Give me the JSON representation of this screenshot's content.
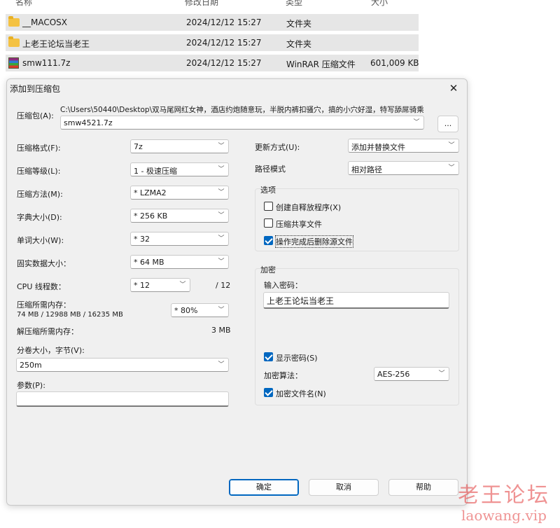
{
  "explorer": {
    "columns": [
      "名称",
      "修改日期",
      "类型",
      "大小"
    ],
    "files": [
      {
        "name": "__MACOSX",
        "date": "2024/12/12 15:27",
        "type": "文件夹",
        "size": "",
        "icon": "folder-icon"
      },
      {
        "name": "上老王论坛当老王",
        "date": "2024/12/12 15:27",
        "type": "文件夹",
        "size": "",
        "icon": "folder-icon"
      },
      {
        "name": "smw111.7z",
        "date": "2024/12/12 15:27",
        "type": "WinRAR 压缩文件",
        "size": "601,009 KB",
        "icon": "winrar-archive-icon"
      }
    ]
  },
  "dialog": {
    "title": "添加到压缩包",
    "archive": {
      "label": "压缩包(A):",
      "path": "C:\\Users\\50440\\Desktop\\双马尾网红女神，酒店约炮随意玩，半脱内裤扣骚穴，搞的小穴好湿，特写舔屌骑乘",
      "filename": "smw4521.7z",
      "browse_label": "..."
    },
    "left": {
      "format": {
        "label": "压缩格式(F):",
        "value": "7z"
      },
      "level": {
        "label": "压缩等级(L):",
        "value": "1 - 极速压缩"
      },
      "method": {
        "label": "压缩方法(M):",
        "value": "* LZMA2"
      },
      "dict": {
        "label": "字典大小(D):",
        "value": "* 256 KB"
      },
      "word": {
        "label": "单词大小(W):",
        "value": "* 32"
      },
      "solid": {
        "label": "固实数据大小：",
        "value": "* 64 MB"
      },
      "cpu": {
        "label": "CPU 线程数：",
        "value": "* 12",
        "max": "/ 12"
      },
      "mem": {
        "label": "压缩所需内存：",
        "detail": "74 MB / 12988 MB / 16235 MB",
        "value": "* 80%"
      },
      "decomp": {
        "label": "解压缩所需内存：",
        "value": "3 MB"
      },
      "split": {
        "label": "分卷大小，字节(V):",
        "value": "250m"
      },
      "params": {
        "label": "参数(P):",
        "value": ""
      }
    },
    "right": {
      "update": {
        "label": "更新方式(U):",
        "value": "添加并替换文件"
      },
      "path_mode": {
        "label": "路径模式",
        "value": "相对路径"
      },
      "options": {
        "title": "选项",
        "items": [
          {
            "label": "创建自释放程序(X)",
            "checked": false
          },
          {
            "label": "压缩共享文件",
            "checked": false
          },
          {
            "label": "操作完成后删除源文件",
            "checked": true
          }
        ]
      },
      "encryption": {
        "title": "加密",
        "password_label": "输入密码：",
        "password_value": "上老王论坛当老王",
        "show_password": {
          "label": "显示密码(S)",
          "checked": true
        },
        "method_label": "加密算法：",
        "method_value": "AES-256",
        "encrypt_names": {
          "label": "加密文件名(N)",
          "checked": true
        }
      }
    },
    "buttons": {
      "ok": "确定",
      "cancel": "取消",
      "help": "帮助"
    }
  },
  "watermark": {
    "cn": "老王论坛",
    "en": "laowang.vip"
  }
}
